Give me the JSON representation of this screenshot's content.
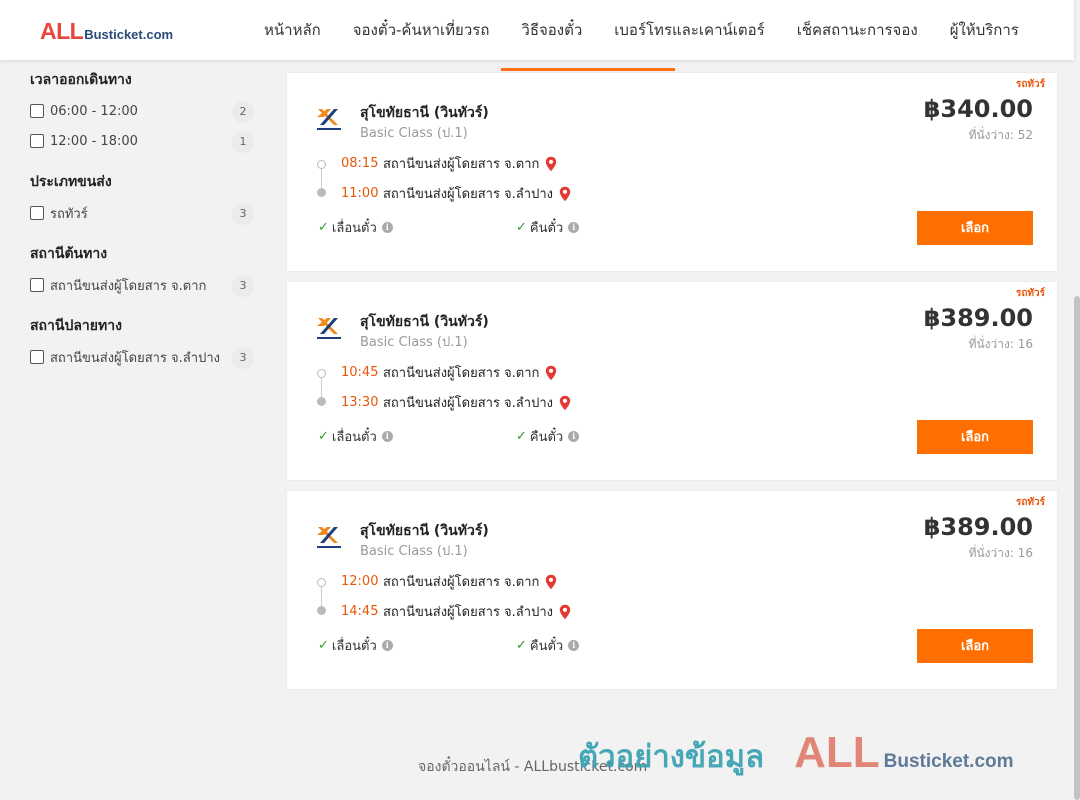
{
  "header": {
    "logo_primary": "ALL",
    "logo_secondary": "Busticket.com",
    "nav": [
      {
        "label": "หน้าหลัก"
      },
      {
        "label": "จองตั๋ว-ค้นหาเที่ยวรถ"
      },
      {
        "label": "วิธีจองตั๋ว"
      },
      {
        "label": "เบอร์โทรและเคาน์เตอร์"
      },
      {
        "label": "เช็คสถานะการจอง"
      },
      {
        "label": "ผู้ให้บริการ"
      }
    ]
  },
  "filters": [
    {
      "title": "เวลาออกเดินทาง",
      "options": [
        {
          "label": "06:00 - 12:00",
          "count": "2"
        },
        {
          "label": "12:00 - 18:00",
          "count": "1"
        }
      ]
    },
    {
      "title": "ประเภทขนส่ง",
      "options": [
        {
          "label": "รถทัวร์",
          "count": "3"
        }
      ]
    },
    {
      "title": "สถานีต้นทาง",
      "options": [
        {
          "label": "สถานีขนส่งผู้โดยสาร จ.ตาก",
          "count": "3"
        }
      ]
    },
    {
      "title": "สถานีปลายทาง",
      "options": [
        {
          "label": "สถานีขนส่งผู้โดยสาร จ.ลำปาง",
          "count": "3"
        }
      ]
    }
  ],
  "trips": [
    {
      "type": "รถทัวร์",
      "operator": "สุโขทัยธานี (วินทัวร์)",
      "bus_class": "Basic Class (ป.1)",
      "price": "฿340.00",
      "seats": "ที่นั่งว่าง: 52",
      "departure_time": "08:15",
      "departure_station": "สถานีขนส่งผู้โดยสาร จ.ตาก",
      "arrival_time": "11:00",
      "arrival_station": "สถานีขนส่งผู้โดยสาร จ.ลำปาง",
      "reschedule": "เลื่อนตั๋ว",
      "refund": "คืนตั๋ว",
      "select": "เลือก"
    },
    {
      "type": "รถทัวร์",
      "operator": "สุโขทัยธานี (วินทัวร์)",
      "bus_class": "Basic Class (ป.1)",
      "price": "฿389.00",
      "seats": "ที่นั่งว่าง: 16",
      "departure_time": "10:45",
      "departure_station": "สถานีขนส่งผู้โดยสาร จ.ตาก",
      "arrival_time": "13:30",
      "arrival_station": "สถานีขนส่งผู้โดยสาร จ.ลำปาง",
      "reschedule": "เลื่อนตั๋ว",
      "refund": "คืนตั๋ว",
      "select": "เลือก"
    },
    {
      "type": "รถทัวร์",
      "operator": "สุโขทัยธานี (วินทัวร์)",
      "bus_class": "Basic Class (ป.1)",
      "price": "฿389.00",
      "seats": "ที่นั่งว่าง: 16",
      "departure_time": "12:00",
      "departure_station": "สถานีขนส่งผู้โดยสาร จ.ตาก",
      "arrival_time": "14:45",
      "arrival_station": "สถานีขนส่งผู้โดยสาร จ.ลำปาง",
      "reschedule": "เลื่อนตั๋ว",
      "refund": "คืนตั๋ว",
      "select": "เลือก"
    }
  ],
  "footer": {
    "text": "จองตั๋วออนไลน์ - ALLbusticket.com"
  },
  "watermark": {
    "thai": "ตัวอย่างข้อมูล",
    "primary": "ALL",
    "secondary": "Busticket.com"
  },
  "icons": {
    "location": "map-pin-icon",
    "check": "check-icon",
    "info": "info-icon",
    "operator_logo": "operator-logo-icon"
  },
  "colors": {
    "accent": "#ff6e00",
    "time": "#e8560a",
    "logo_red": "#e8463a",
    "logo_navy": "#2a4a78",
    "pin": "#e53935",
    "check": "#2e9e2e",
    "watermark_thai": "#3aa1b1"
  }
}
